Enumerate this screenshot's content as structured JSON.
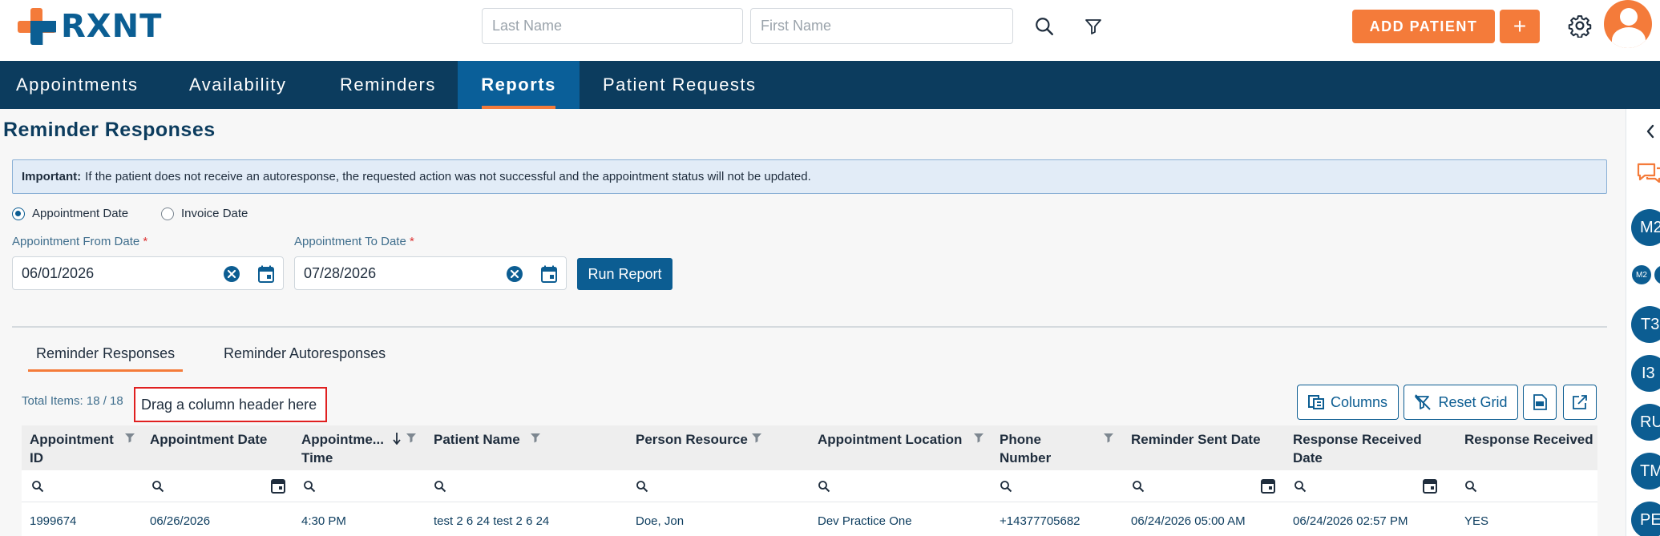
{
  "app": {
    "logo_text": "RXNT"
  },
  "header": {
    "last_name_placeholder": "Last Name",
    "first_name_placeholder": "First Name",
    "add_patient_label": "ADD PATIENT",
    "plus_label": "+"
  },
  "nav": {
    "items": [
      {
        "label": "Appointments"
      },
      {
        "label": "Availability"
      },
      {
        "label": "Reminders"
      },
      {
        "label": "Reports",
        "active": true
      },
      {
        "label": "Patient Requests"
      }
    ]
  },
  "page": {
    "title": "Reminder Responses",
    "notice_bold": "Important:",
    "notice_text": "If the patient does not receive an autoresponse, the requested action was not successful and the appointment status will not be updated.",
    "radio_appointment_date": "Appointment Date",
    "radio_invoice_date": "Invoice Date",
    "from_label": "Appointment From Date",
    "to_label": "Appointment To Date",
    "required_mark": "*",
    "from_value": "06/01/2026",
    "to_value": "07/28/2026",
    "run_report": "Run Report"
  },
  "tabs": [
    {
      "label": "Reminder Responses",
      "active": true
    },
    {
      "label": "Reminder Autoresponses"
    }
  ],
  "grid": {
    "total_items": "Total Items: 18 / 18",
    "drag_hint": "Drag a column header here",
    "columns_button": "Columns",
    "reset_grid_button": "Reset Grid",
    "headers": [
      {
        "line1": "Appointment",
        "line2": "ID"
      },
      {
        "line1": "Appointment Date",
        "line2": ""
      },
      {
        "line1": "Appointme...",
        "line2": "Time"
      },
      {
        "line1": "Patient Name",
        "line2": ""
      },
      {
        "line1": "Person Resource",
        "line2": ""
      },
      {
        "line1": "Appointment Location",
        "line2": ""
      },
      {
        "line1": "Phone",
        "line2": "Number"
      },
      {
        "line1": "Reminder Sent Date",
        "line2": ""
      },
      {
        "line1": "Response Received",
        "line2": "Date"
      },
      {
        "line1": "Response Received",
        "line2": ""
      }
    ],
    "rows": [
      {
        "appointment_id": "1999674",
        "appointment_date": "06/26/2026",
        "appointment_time": "4:30 PM",
        "patient_name": "test 2 6 24 test 2 6 24",
        "person_resource": "Doe, Jon",
        "location": "Dev Practice One",
        "phone": "+14377705682",
        "reminder_sent": "06/24/2026 05:00 AM",
        "response_date": "06/24/2026 02:57 PM",
        "response": "YES"
      }
    ]
  },
  "rail": {
    "items": [
      "M2",
      "T3",
      "I3",
      "RU",
      "TM",
      "PE"
    ],
    "small_badge": "M2"
  },
  "colors": {
    "brand_orange": "#f47b3a",
    "brand_blue": "#0c5d92",
    "nav_bg": "#0c3c5e"
  }
}
